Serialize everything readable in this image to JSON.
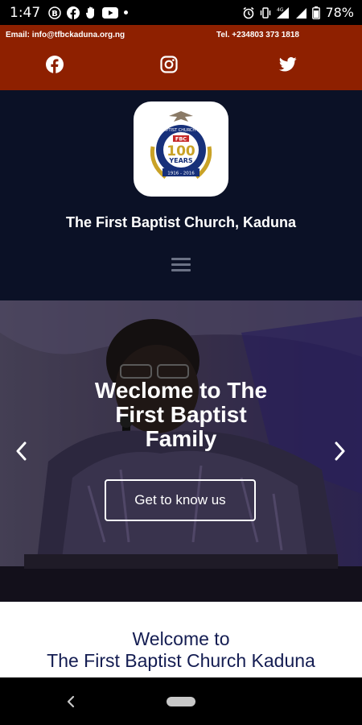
{
  "status_bar": {
    "time": "1:47",
    "battery": "78%",
    "icons": [
      "b-badge-icon",
      "facebook-icon",
      "hand-icon",
      "youtube-icon",
      "dot-icon",
      "alarm-icon",
      "vibrate-icon",
      "lte-icon",
      "signal-icon",
      "battery-icon"
    ]
  },
  "contact_bar": {
    "email": "Email: info@tfbckaduna.org.ng",
    "phone": "Tel. +234803 373 1818",
    "social": [
      "facebook",
      "instagram",
      "twitter"
    ]
  },
  "header": {
    "site_title": "The First Baptist Church, Kaduna",
    "logo": {
      "ring_text": "FIRST BAPTIST CHURCH KADUNA",
      "badge": "FBC",
      "number": "100",
      "word": "YEARS",
      "years": "1916 - 2016"
    }
  },
  "hero": {
    "title_line1": "Weclome to The",
    "title_line2": "First Baptist",
    "title_line3": "Family",
    "button": "Get to know us"
  },
  "welcome": {
    "line1": "Welcome to",
    "line2": "The First Baptist Church Kaduna"
  },
  "colors": {
    "topbar": "#8e2000",
    "header": "#0b1126",
    "welcome_text": "#141d52"
  }
}
